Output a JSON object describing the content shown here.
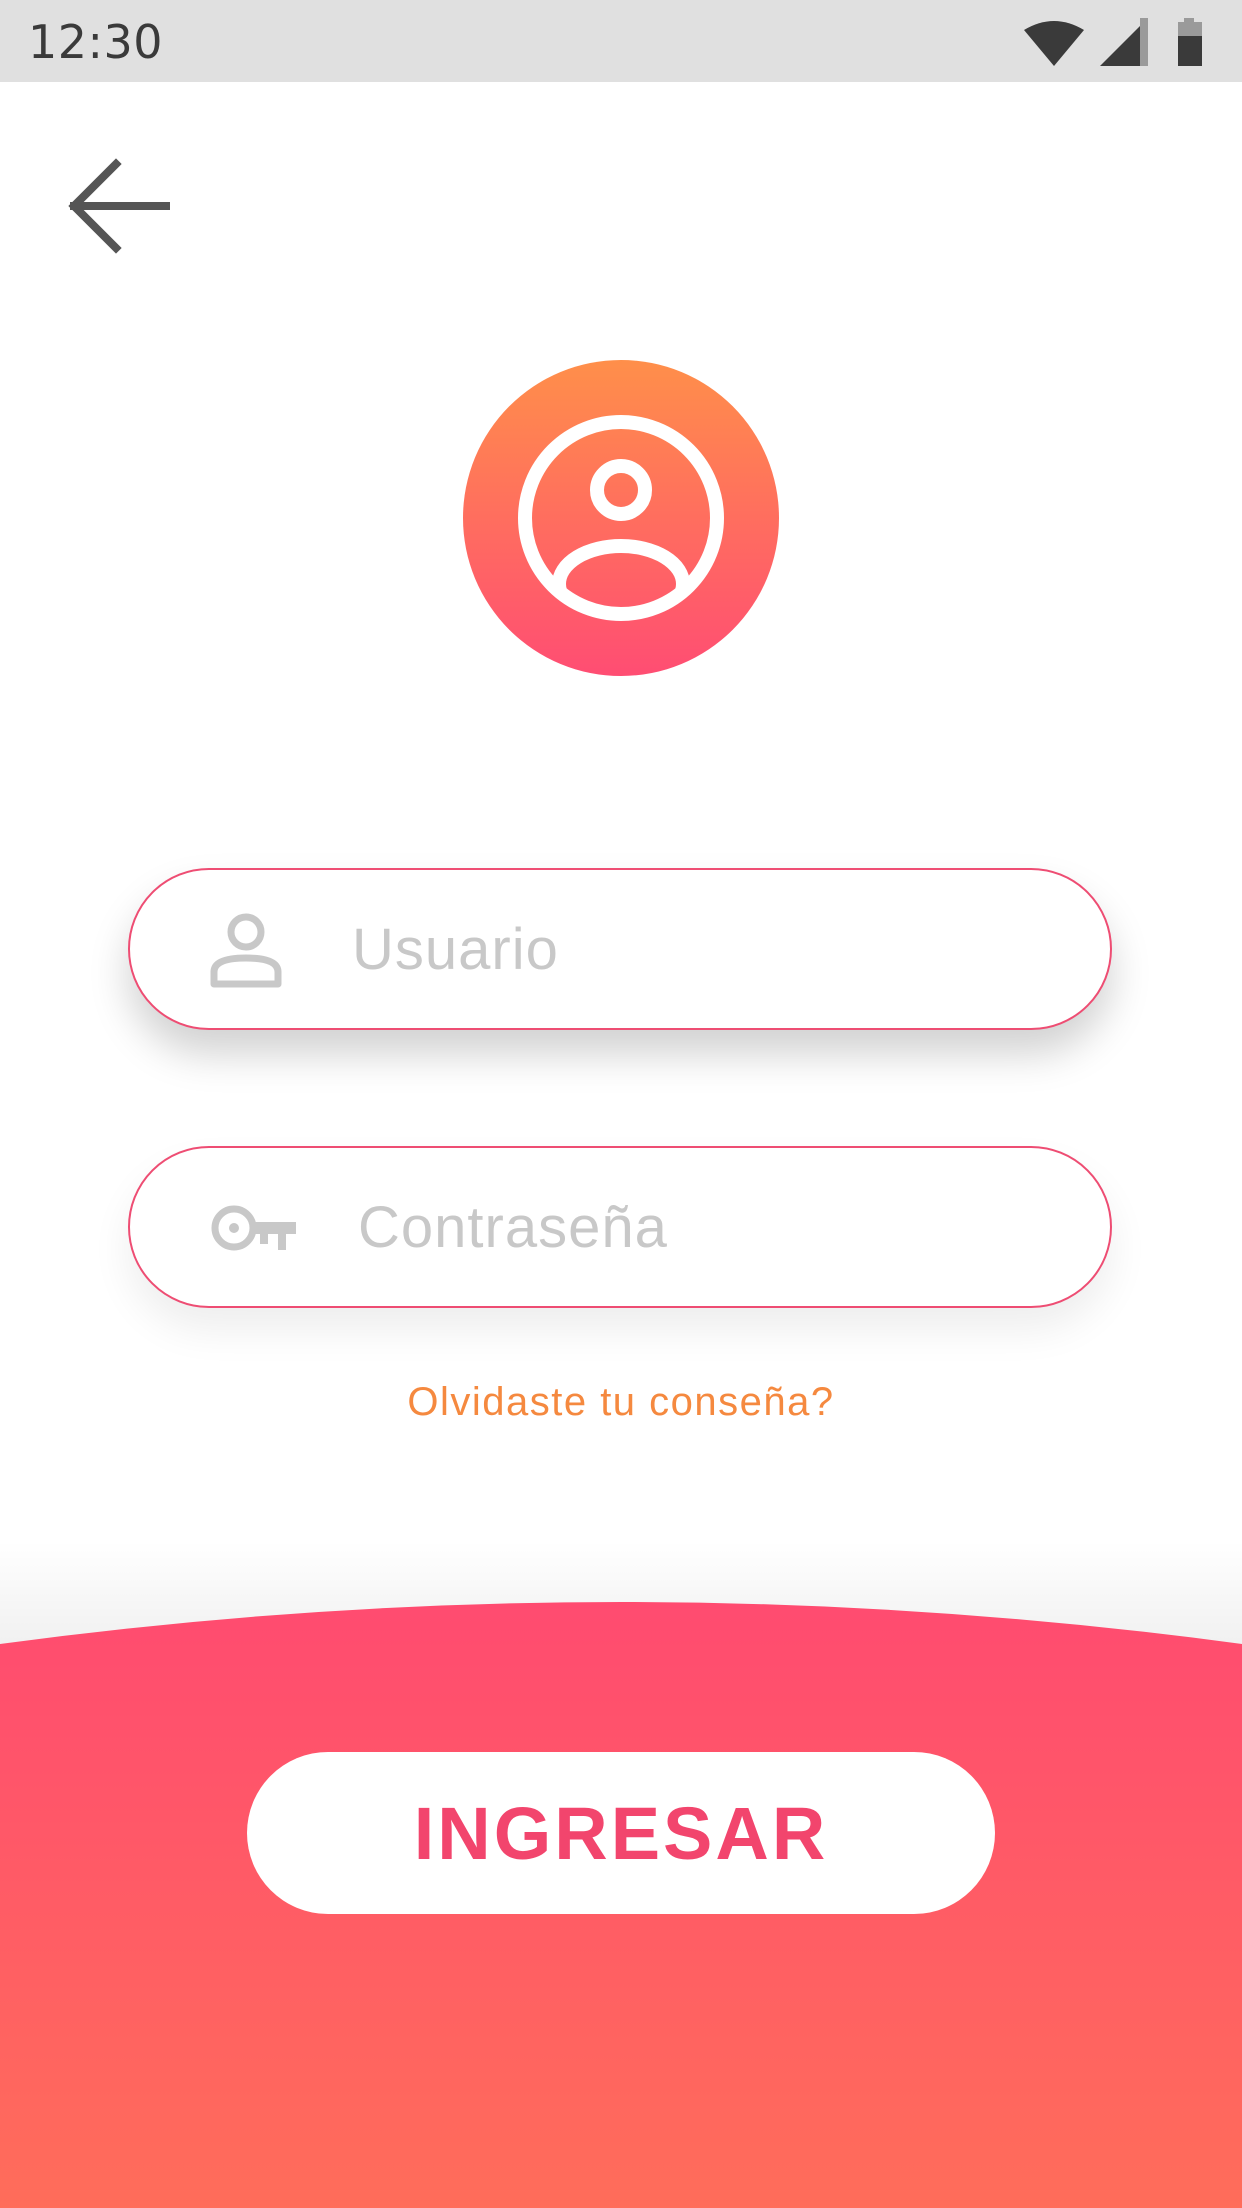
{
  "status_bar": {
    "time": "12:30",
    "icons": [
      "wifi-icon",
      "cellular-signal-icon",
      "battery-icon"
    ]
  },
  "header": {
    "back_icon": "arrow-left-icon"
  },
  "logo": {
    "icon": "user-circle-icon",
    "gradient": [
      "#ff8f4a",
      "#ff4d73"
    ]
  },
  "form": {
    "username": {
      "icon": "person-icon",
      "placeholder": "Usuario",
      "value": ""
    },
    "password": {
      "icon": "key-icon",
      "placeholder": "Contraseña",
      "value": ""
    },
    "forgot_label": "Olvidaste tu conseña?"
  },
  "footer": {
    "submit_label": "INGRESAR",
    "gradient": [
      "#ff4b70",
      "#ff6d5a"
    ]
  },
  "colors": {
    "accent_pink": "#f2456d",
    "accent_orange": "#f5893f",
    "placeholder": "#c8c8c8",
    "status_bar_bg": "#e0e0e0"
  }
}
